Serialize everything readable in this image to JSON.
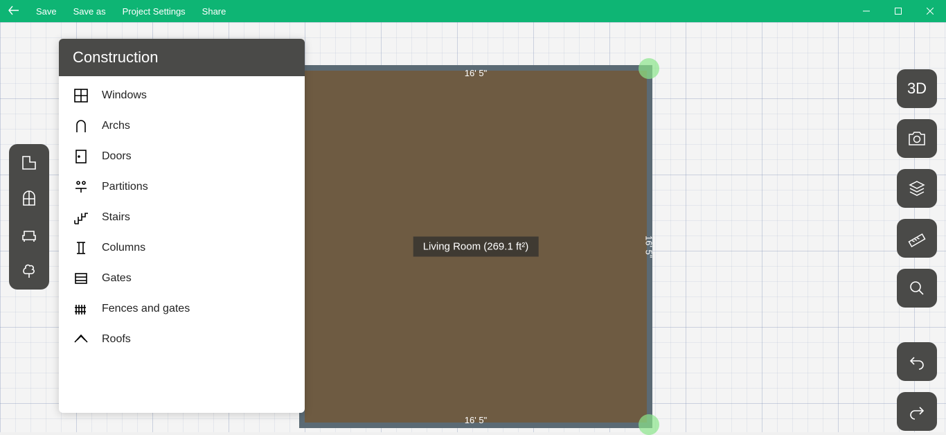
{
  "menubar": {
    "items": [
      "Save",
      "Save as",
      "Project Settings",
      "Share"
    ]
  },
  "panel": {
    "title": "Construction",
    "items": [
      {
        "label": "Windows"
      },
      {
        "label": "Archs"
      },
      {
        "label": "Doors"
      },
      {
        "label": "Partitions"
      },
      {
        "label": "Stairs"
      },
      {
        "label": "Columns"
      },
      {
        "label": "Gates"
      },
      {
        "label": "Fences and gates"
      },
      {
        "label": "Roofs"
      }
    ]
  },
  "right_toolbar": {
    "view3d_label": "3D"
  },
  "room": {
    "label": "Living Room (269.1 ft²)",
    "dim_top": "16' 5\"",
    "dim_bottom": "16' 5\"",
    "dim_right": "16' 5\""
  },
  "colors": {
    "brand": "#0eb574",
    "panel_dark": "#4a4a48",
    "room_fill": "#6e5b42",
    "room_wall": "#5b6a74"
  }
}
